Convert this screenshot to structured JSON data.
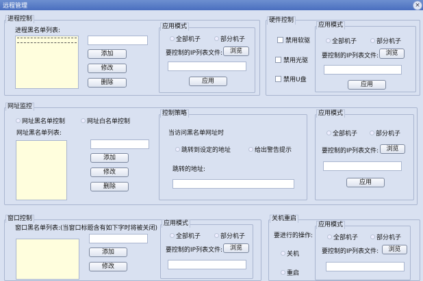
{
  "window": {
    "title": "远程管理",
    "close": "×"
  },
  "common": {
    "all": "全部机子",
    "part": "部分机子",
    "ip_file": "要控制的IP列表文件:",
    "browse": "浏览",
    "apply": "应用",
    "mode": "应用模式",
    "add": "添加",
    "edit": "修改",
    "delete": "删除"
  },
  "process": {
    "title": "进程控制",
    "list_label": "进程黑名单列表:"
  },
  "hardware": {
    "title": "硬件控制",
    "floppy": "禁用软驱",
    "cdrom": "禁用光驱",
    "usb": "禁用U盘"
  },
  "url": {
    "title": "网址监控",
    "blacklist_ctrl": "网址黑名单控制",
    "whitelist_ctrl": "网址白名单控制",
    "list_label": "网址黑名单列表:",
    "strategy": "控制策略",
    "when": "当访问黑名单网址时",
    "redirect": "跳转到设定的地址",
    "warn": "给出警告提示",
    "redirect_addr": "跳转的地址:"
  },
  "window_ctrl": {
    "title": "窗口控制",
    "list_label": "窗口黑名单列表:(当窗口标题含有如下字时将被关闭)"
  },
  "shutdown": {
    "title": "关机重启",
    "op_label": "要进行的操作:",
    "shutdown": "关机",
    "restart": "重启"
  }
}
